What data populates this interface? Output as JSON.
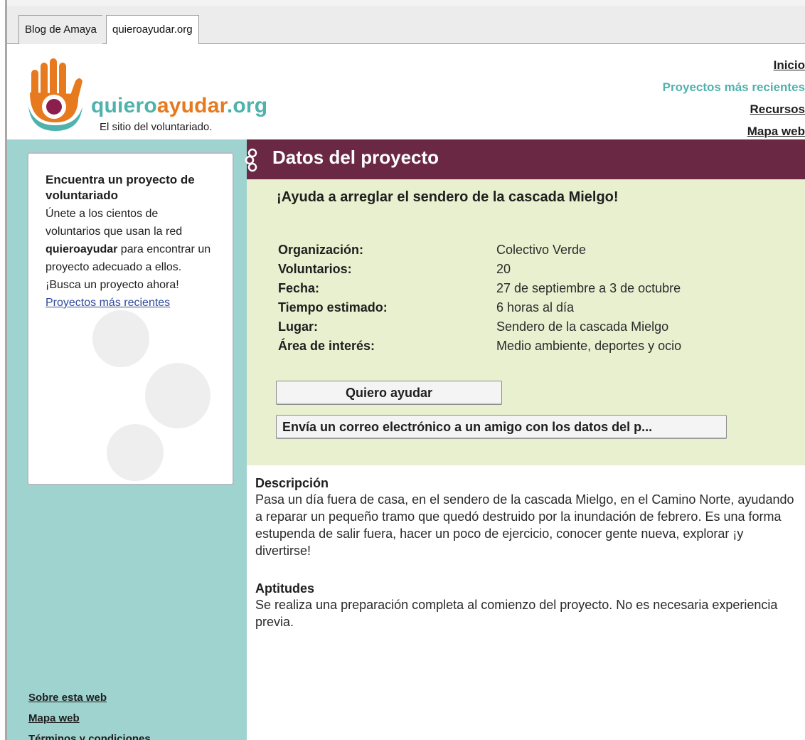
{
  "tabs": [
    {
      "label": "Blog de Amaya",
      "active": false
    },
    {
      "label": "quieroayudar.org",
      "active": true
    }
  ],
  "header": {
    "logo": {
      "part_a": "quiero",
      "part_b": "ayudar",
      "part_c": ".org"
    },
    "tagline": "El sitio del voluntariado.",
    "nav": [
      {
        "label": "Inicio",
        "current": false
      },
      {
        "label": "Proyectos más recientes",
        "current": true
      },
      {
        "label": "Recursos",
        "current": false
      },
      {
        "label": "Mapa web",
        "current": false
      }
    ]
  },
  "sidebar": {
    "promo": {
      "title": "Encuentra un proyecto de voluntariado",
      "body_before": "Únete a los cientos de voluntarios que usan la red ",
      "body_bold": "quieroayudar",
      "body_after": " para encontrar un proyecto adecuado a ellos. ¡Busca un proyecto ahora!",
      "link": "Proyectos más recientes"
    },
    "footer_links": [
      "Sobre esta web",
      "Mapa web",
      "Términos y condiciones"
    ]
  },
  "main": {
    "panel_title": "Datos del proyecto",
    "project_title": "¡Ayuda a arreglar el sendero de la cascada Mielgo!",
    "facts": [
      {
        "label": "Organización:",
        "value": "Colectivo Verde"
      },
      {
        "label": "Voluntarios:",
        "value": "20"
      },
      {
        "label": "Fecha:",
        "value": "27 de septiembre a 3 de octubre"
      },
      {
        "label": "Tiempo estimado:",
        "value": "6 horas al día"
      },
      {
        "label": "Lugar:",
        "value": "Sendero de la cascada Mielgo"
      },
      {
        "label": "Área de interés:",
        "value": "Medio ambiente, deportes y ocio"
      }
    ],
    "buttons": {
      "help": "Quiero ayudar",
      "email": "Envía un correo electrónico a un amigo con los datos del p..."
    },
    "description": {
      "title": "Descripción",
      "body": "Pasa un día fuera de casa, en el sendero de la cascada Mielgo, en el Camino Norte, ayudando a reparar un pequeño tramo que quedó destruido por la inundación de febrero. Es una forma estupenda de salir fuera, hacer un poco de ejercicio, conocer gente nueva, explorar ¡y divertirse!"
    },
    "skills": {
      "title": "Aptitudes",
      "body": "Se realiza una preparación completa al comienzo del proyecto. No es necesaria experiencia previa."
    }
  },
  "colors": {
    "teal": "#4fb2ad",
    "orange": "#e7791f",
    "plum": "#6b2844",
    "sidebar_bg": "#9fd3cf",
    "details_bg": "#e9f0d0"
  },
  "icons": [
    "hand-logo-icon",
    "flower-icon"
  ]
}
